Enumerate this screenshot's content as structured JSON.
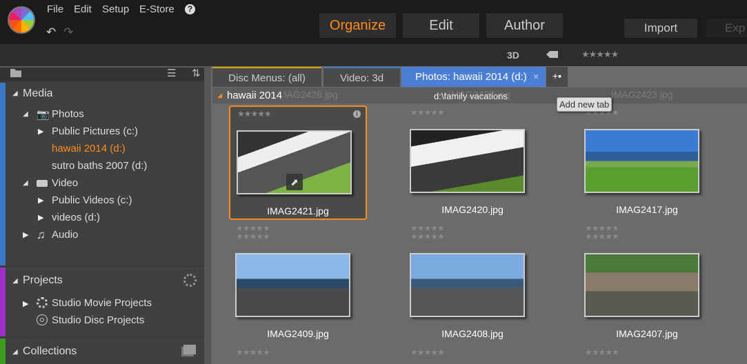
{
  "menu": {
    "file": "File",
    "edit": "Edit",
    "setup": "Setup",
    "estore": "E-Store",
    "help": "?"
  },
  "modes": {
    "organize": "Organize",
    "edit": "Edit",
    "author": "Author",
    "import": "Import",
    "export": "Exp"
  },
  "toolbar": {
    "threed": "3D",
    "stars": "★★★★★"
  },
  "accent": "#ff8c1a",
  "sidebar": {
    "media": "Media",
    "photos": "Photos",
    "public_pictures": "Public Pictures (c:)",
    "hawaii": "hawaii 2014 (d:)",
    "sutro": "sutro baths 2007 (d:)",
    "video": "Video",
    "public_videos": "Public Videos (c:)",
    "videos": "videos (d:)",
    "audio": "Audio",
    "projects": "Projects",
    "movie_projects": "Studio Movie Projects",
    "disc_projects": "Studio Disc Projects",
    "collections": "Collections"
  },
  "tabs": [
    {
      "label": "Disc Menus: (all)"
    },
    {
      "label": "Video: 3d"
    },
    {
      "label": "Photos: hawaii 2014 (d:)",
      "close": "×"
    }
  ],
  "tooltip": "Add new tab",
  "group": {
    "title": "hawaii 2014",
    "path": "d:\\family vacations",
    "ghost": [
      "IMAG2428.jpg",
      "IMAG2427.jpg",
      "IMAG2423.jpg"
    ]
  },
  "items": [
    {
      "name": "IMAG2421.jpg",
      "stars": "★★★★★"
    },
    {
      "name": "IMAG2420.jpg",
      "stars": "★★★★★"
    },
    {
      "name": "IMAG2417.jpg",
      "stars": "★★★★★"
    },
    {
      "name": "IMAG2409.jpg",
      "stars": "★★★★★"
    },
    {
      "name": "IMAG2408.jpg",
      "stars": "★★★★★"
    },
    {
      "name": "IMAG2407.jpg",
      "stars": "★★★★★"
    }
  ]
}
